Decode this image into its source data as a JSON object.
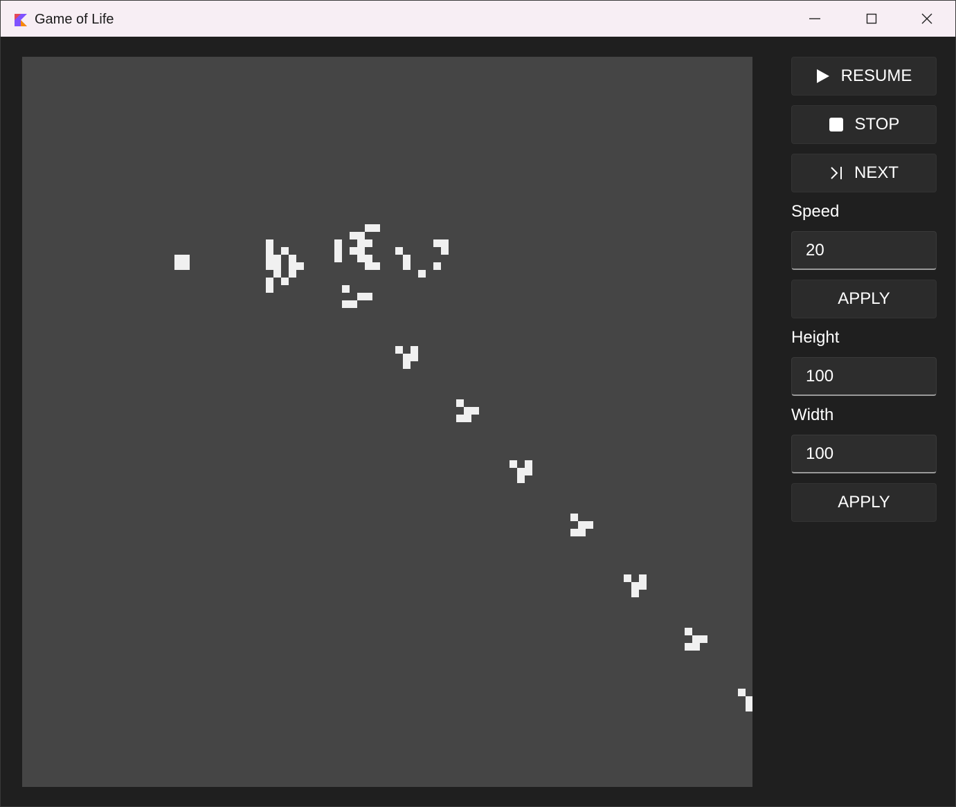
{
  "window": {
    "title": "Game of Life"
  },
  "controls": {
    "resume_label": "RESUME",
    "stop_label": "STOP",
    "next_label": "NEXT",
    "speed_label": "Speed",
    "speed_value": "20",
    "apply_speed_label": "APPLY",
    "height_label": "Height",
    "height_value": "100",
    "width_label": "Width",
    "width_value": "100",
    "apply_size_label": "APPLY"
  },
  "colors": {
    "alive_cell": "#f0f0f0",
    "dead_background": "#454545",
    "panel_background": "#1f1f1f",
    "titlebar": "#f7eef4"
  },
  "icons": {
    "resume": "play-icon",
    "stop": "stop-icon",
    "next": "skip-next-icon"
  }
}
